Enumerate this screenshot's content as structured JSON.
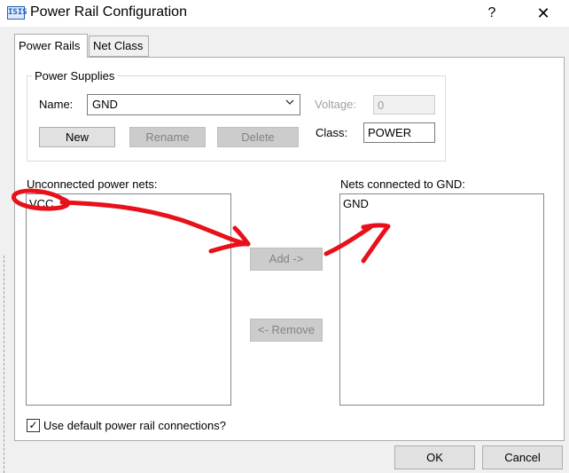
{
  "window": {
    "title": "Power Rail Configuration",
    "icon_text": "ISIS",
    "help_glyph": "?",
    "close_glyph": "✕"
  },
  "tabs": [
    {
      "label": "Power Rails",
      "active": true
    },
    {
      "label": "Net Class",
      "active": false
    }
  ],
  "power_supplies": {
    "group_label": "Power Supplies",
    "name_label": "Name:",
    "name_value": "GND",
    "voltage_label": "Voltage:",
    "voltage_value": "0",
    "class_label": "Class:",
    "class_value": "POWER",
    "new_label": "New",
    "rename_label": "Rename",
    "delete_label": "Delete"
  },
  "unconnected": {
    "label": "Unconnected power nets:",
    "items": [
      "VCC"
    ]
  },
  "connected": {
    "label": "Nets connected to GND:",
    "items": [
      "GND"
    ]
  },
  "actions": {
    "add_label": "Add ->",
    "remove_label": "<- Remove"
  },
  "default_connections": {
    "label": "Use default power rail connections?",
    "checked": true,
    "check_glyph": "✓"
  },
  "footer": {
    "ok_label": "OK",
    "cancel_label": "Cancel"
  },
  "colors": {
    "annotation": "#e8101a",
    "window_bg": "#f0f0f0"
  }
}
